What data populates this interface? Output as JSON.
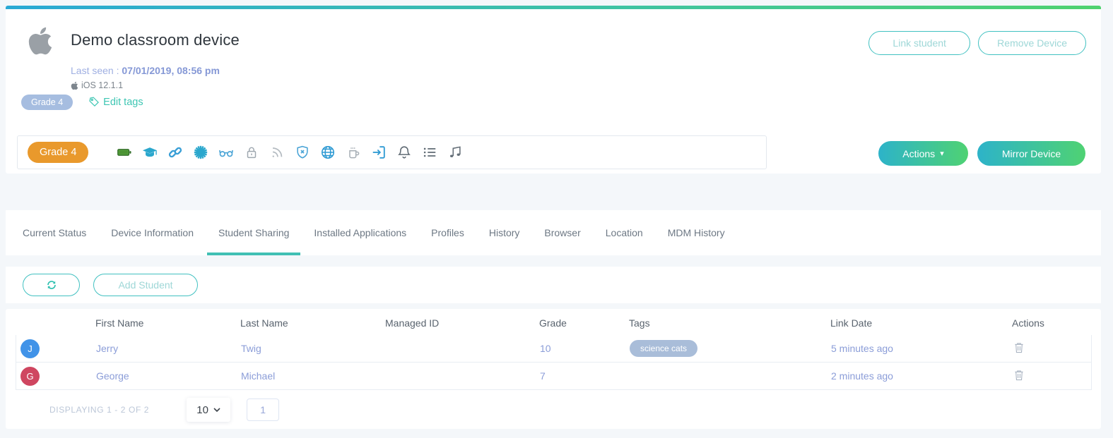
{
  "header": {
    "title": "Demo classroom device",
    "last_seen_label": "Last seen :",
    "last_seen_value": "07/01/2019, 08:56 pm",
    "os_version": "iOS 12.1.1",
    "grade_badge": "Grade 4",
    "edit_tags_label": "Edit tags",
    "link_student_button": "Link student",
    "remove_device_button": "Remove Device"
  },
  "toolbar": {
    "group_badge": "Grade 4",
    "icons": [
      "battery-icon",
      "graduation-cap-icon",
      "chain-link-icon",
      "burst-icon",
      "glasses-icon",
      "lock-icon",
      "rss-icon",
      "shield-x-icon",
      "globe-icon",
      "mug-icon",
      "sign-in-icon",
      "bell-icon",
      "list-icon",
      "music-note-icon"
    ],
    "actions_button": "Actions",
    "actions_caret": "▾",
    "mirror_device_button": "Mirror Device"
  },
  "tabs": {
    "active": "Student Sharing",
    "items": [
      {
        "label": "Current Status"
      },
      {
        "label": "Device Information"
      },
      {
        "label": "Student Sharing"
      },
      {
        "label": "Installed Applications"
      },
      {
        "label": "Profiles"
      },
      {
        "label": "History"
      },
      {
        "label": "Browser"
      },
      {
        "label": "Location"
      },
      {
        "label": "MDM History"
      }
    ]
  },
  "student_sharing": {
    "add_student_button": "Add Student",
    "table": {
      "columns": [
        "First Name",
        "Last Name",
        "Managed ID",
        "Grade",
        "Tags",
        "Link Date",
        "Actions"
      ],
      "rows": [
        {
          "avatar_letter": "J",
          "avatar_color": "#4193e8",
          "first_name": "Jerry",
          "last_name": "Twig",
          "managed_id": "",
          "grade": "10",
          "tags": [
            "science cats"
          ],
          "link_date": "5 minutes ago"
        },
        {
          "avatar_letter": "G",
          "avatar_color": "#cf4660",
          "first_name": "George",
          "last_name": "Michael",
          "managed_id": "",
          "grade": "7",
          "tags": [],
          "link_date": "2 minutes ago"
        }
      ]
    },
    "pagination": {
      "displaying": "DISPLAYING 1 - 2 OF 2",
      "page_size": "10",
      "page": "1"
    }
  },
  "colors": {
    "accent_teal": "#41c1c1",
    "active_tab_underline": "#41c0b4",
    "gradient_start": "#2aa9d5",
    "gradient_end": "#4fd26f",
    "grade_chip_orange": "#e9992c",
    "badge_slate": "#a6bde0",
    "tag_pill": "#a9bdd9",
    "link_text": "#8b9dd8",
    "avatar_blue": "#4193e8",
    "avatar_red": "#cf4660",
    "page_background": "#f4f7fa"
  }
}
